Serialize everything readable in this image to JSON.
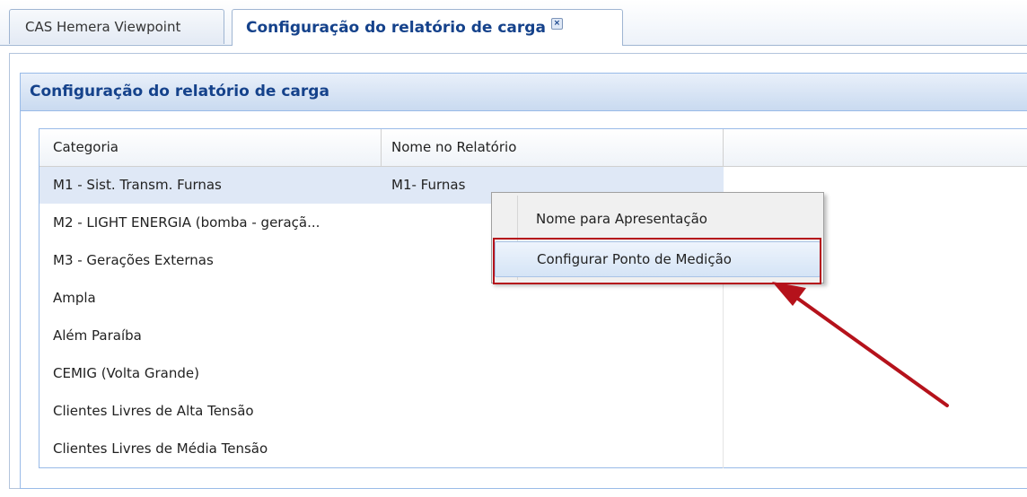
{
  "tabs": [
    {
      "label": "CAS Hemera Viewpoint",
      "active": false
    },
    {
      "label": "Configuração do relatório de carga",
      "active": true,
      "closable": true
    }
  ],
  "tab_close_icon": "close-icon",
  "panel": {
    "title": "Configuração do relatório de carga"
  },
  "grid": {
    "columns": [
      "Categoria",
      "Nome no Relatório",
      ""
    ],
    "rows": [
      {
        "categoria": "M1 - Sist. Transm. Furnas",
        "nome": "M1- Furnas",
        "selected": true
      },
      {
        "categoria": "M2 - LIGHT ENERGIA (bomba - geraçã...",
        "nome": ""
      },
      {
        "categoria": "M3 - Gerações Externas",
        "nome": ""
      },
      {
        "categoria": "Ampla",
        "nome": ""
      },
      {
        "categoria": "Além Paraíba",
        "nome": ""
      },
      {
        "categoria": "CEMIG (Volta Grande)",
        "nome": ""
      },
      {
        "categoria": "Clientes Livres de Alta Tensão",
        "nome": ""
      },
      {
        "categoria": "Clientes Livres de Média Tensão",
        "nome": ""
      }
    ]
  },
  "context_menu": {
    "items": [
      {
        "label": "Nome para Apresentação"
      },
      {
        "label": "Configurar Ponto de Medição",
        "highlighted": true
      }
    ]
  },
  "colors": {
    "header_text": "#15428b",
    "selection": "#dfe8f6",
    "annotation": "#b5121b"
  }
}
